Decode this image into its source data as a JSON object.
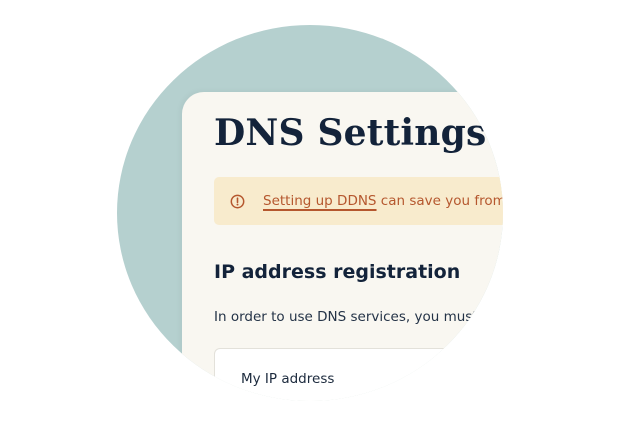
{
  "page": {
    "title": "DNS Settings"
  },
  "alert": {
    "icon": "exclamation-circle-icon",
    "link_text": "Setting up DDNS",
    "text": " can save you from",
    "color": "#b5572e",
    "background": "#f8ebcd"
  },
  "ip_registration": {
    "heading": "IP address registration",
    "description": "In order to use DNS services, you must",
    "field_label": "My IP address"
  },
  "colors": {
    "circle_background": "#b5d0cf",
    "card_background": "#f9f7f1",
    "title_color": "#13233a"
  }
}
